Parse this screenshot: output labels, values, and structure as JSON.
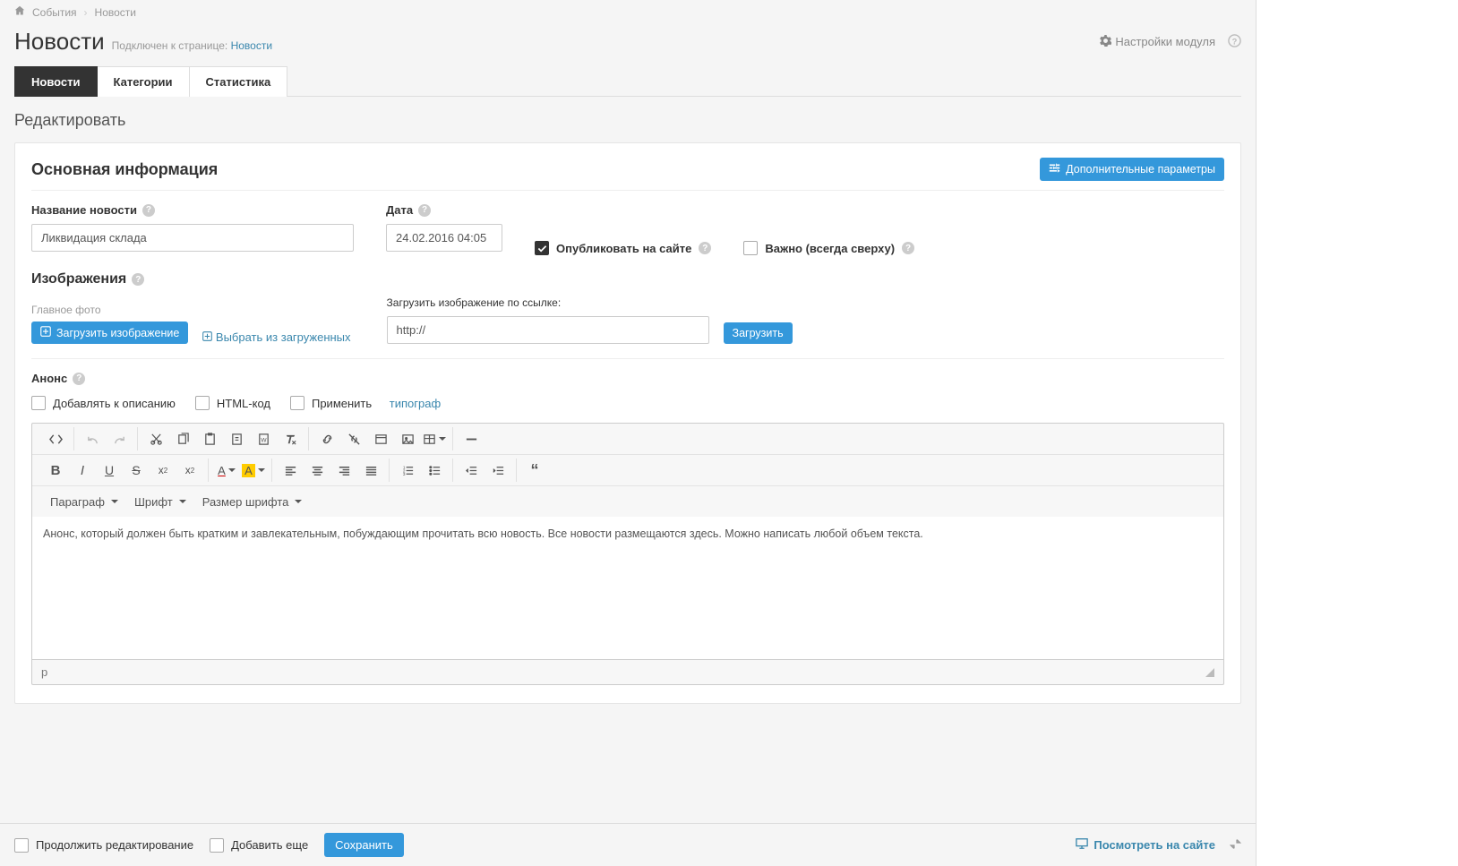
{
  "breadcrumb": {
    "item1": "События",
    "item2": "Новости"
  },
  "page": {
    "title": "Новости",
    "subtitle_prefix": "Подключен к странице:",
    "subtitle_link": "Новости",
    "settings_label": "Настройки модуля"
  },
  "tabs": {
    "news": "Новости",
    "categories": "Категории",
    "stats": "Статистика"
  },
  "section": {
    "edit_title": "Редактировать"
  },
  "card": {
    "title": "Основная информация",
    "more_params_btn": "Дополнительные параметры"
  },
  "form": {
    "name_label": "Название новости",
    "name_value": "Ликвидация склада",
    "date_label": "Дата",
    "date_value": "24.02.2016 04:05",
    "publish_label": "Опубликовать на сайте",
    "publish_checked": true,
    "important_label": "Важно (всегда сверху)",
    "important_checked": false
  },
  "images": {
    "section_label": "Изображения",
    "main_photo_label": "Главное фото",
    "upload_btn": "Загрузить изображение",
    "pick_link": "Выбрать из загруженных",
    "url_label": "Загрузить изображение по ссылке:",
    "url_value": "http://",
    "load_btn": "Загрузить"
  },
  "anons": {
    "label": "Анонс",
    "add_to_desc": "Добавлять к описанию",
    "html_code": "HTML-код",
    "apply_prefix": "Применить",
    "typograf_link": "типограф"
  },
  "editor": {
    "paragraph": "Параграф",
    "font": "Шрифт",
    "font_size": "Размер шрифта",
    "body_text": "Анонс, который должен быть кратким и завлекательным, побуждающим прочитать всю новость. Все новости размещаются здесь. Можно написать любой объем текста.",
    "status_path": "p"
  },
  "footer": {
    "continue_edit": "Продолжить редактирование",
    "add_more": "Добавить еще",
    "save_btn": "Сохранить",
    "view_on_site": "Посмотреть на сайте"
  }
}
